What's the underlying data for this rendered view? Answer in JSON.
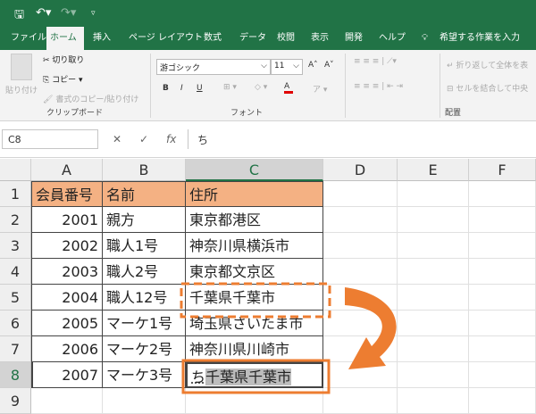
{
  "qat": {
    "save": "save-icon",
    "undo": "undo-icon",
    "redo": "redo-icon",
    "customize": "customize-icon"
  },
  "tabs": [
    "ファイル",
    "ホーム",
    "挿入",
    "ページ レイアウト",
    "数式",
    "データ",
    "校閲",
    "表示",
    "開発",
    "ヘルプ"
  ],
  "tell_me": "希望する作業を入力",
  "ribbon": {
    "clipboard": {
      "paste": "貼り付け",
      "cut": "切り取り",
      "copy": "コピー",
      "format_painter": "書式のコピー/貼り付け",
      "label": "クリップボード"
    },
    "font": {
      "font_name": "游ゴシック",
      "font_size": "11",
      "bold": "B",
      "italic": "I",
      "underline": "U",
      "font_color": "A",
      "label": "フォント"
    },
    "alignment": {
      "wrap": "折り返して全体を表",
      "merge": "セルを結合して中央",
      "label": "配置"
    }
  },
  "formula_bar": {
    "name_box": "C8",
    "cancel": "✕",
    "enter": "✓",
    "fx": "fx",
    "value": "ち"
  },
  "columns": [
    "A",
    "B",
    "C",
    "D",
    "E",
    "F"
  ],
  "rows": [
    {
      "n": "1",
      "a": "会員番号",
      "b": "名前",
      "c": "住所"
    },
    {
      "n": "2",
      "a": "2001",
      "b": "親方",
      "c": "東京都港区"
    },
    {
      "n": "3",
      "a": "2002",
      "b": "職人1号",
      "c": "神奈川県横浜市"
    },
    {
      "n": "4",
      "a": "2003",
      "b": "職人2号",
      "c": "東京都文京区"
    },
    {
      "n": "5",
      "a": "2004",
      "b": "職人12号",
      "c": "千葉県千葉市"
    },
    {
      "n": "6",
      "a": "2005",
      "b": "マーケ1号",
      "c": "埼玉県さいたま市"
    },
    {
      "n": "7",
      "a": "2006",
      "b": "マーケ2号",
      "c": "神奈川県川崎市"
    },
    {
      "n": "8",
      "a": "2007",
      "b": "マーケ3号",
      "c": ""
    },
    {
      "n": "9",
      "a": "",
      "b": "",
      "c": ""
    }
  ],
  "active_cell": {
    "typed": "ち",
    "autocomplete": "千葉県千葉市"
  },
  "colors": {
    "accent": "#217346",
    "header_fill": "#f4b183",
    "annotation": "#ed7d31"
  }
}
